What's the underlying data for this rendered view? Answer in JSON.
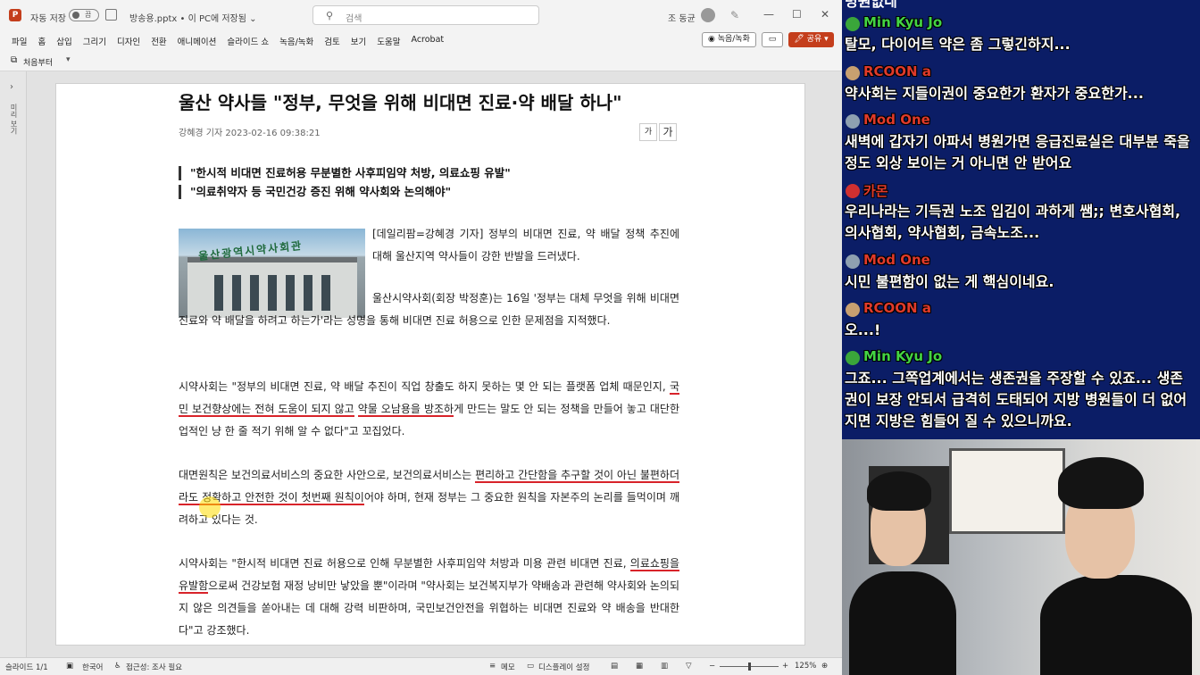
{
  "titlebar": {
    "app_icon": "P",
    "autosave_label": "자동 저장",
    "autosave_state": "끔",
    "filename": "방송용.pptx • 이 PC에 저장됨 ⌄",
    "search_placeholder": "검색",
    "user_name": "조 동균",
    "icons": [
      "powerpoint-icon",
      "save-icon",
      "search-icon",
      "user-avatar-icon",
      "pen-icon",
      "minimize-icon",
      "maximize-icon",
      "close-icon"
    ]
  },
  "menu": {
    "tabs": [
      "파일",
      "홈",
      "삽입",
      "그리기",
      "디자인",
      "전환",
      "애니메이션",
      "슬라이드 쇼",
      "녹음/녹화",
      "검토",
      "보기",
      "도움말",
      "Acrobat"
    ],
    "record_button": "◉ 녹음/녹화",
    "comment_button": "▭",
    "share_button": "🖊 공유 ▾"
  },
  "qat": {
    "from_start": "처음부터",
    "more": "▾"
  },
  "leftstrip": {
    "label": "미리 보기"
  },
  "article": {
    "headline": "울산 약사들 \"정부, 무엇을 위해 비대면 진료·약 배달 하나\"",
    "byline": "강혜경 기자  2023-02-16 09:38:21",
    "font_small": "가",
    "font_large": "가",
    "summary": [
      "\"한시적 비대면 진료허용 무분별한 사후피임약 처방, 의료쇼핑 유발\"",
      "\"의료취약자 등 국민건강 증진 위해 약사회와 논의해야\""
    ],
    "photo_sign": "울산광역시약사회관",
    "p1": "[데일리팜=강혜경 기자] 정부의 비대면 진료, 약 배달 정책 추진에 대해 울산지역 약사들이 강한 반발을 드러냈다.",
    "p2": "울산시약사회(회장 박정훈)는 16일 '정부는 대체 무엇을 위해 비대면 진료와 약 배달을 하려고 하는가'라는 성명을 통해 비대면 진료 허용으로 인한 문제점을 지적했다.",
    "p3": {
      "a": "시약사회는 \"정부의 비대면 진료, 약 배달 추진이 직업 창출도 하지 못하는 몇 안 되는 플랫폼 업체 때문인지, ",
      "u1": "국민 보건향상에는 전혀 도움이 되지 않고",
      "b": " ",
      "u2": "약물 오남용을 방조하",
      "c": "게 만드는 말도 안 되는 정책을 만들어 놓고 대단한 업적인 냥 한 줄 적기 위해 알 수 없다\"고 꼬집었다."
    },
    "p4": {
      "a": "대면원칙은 보건의료서비스의 중요한 사안으로, 보건의료서비스는 ",
      "u1": "편리하고 간단함을 추구할 것이 아닌 불편하더라도 정확하고 안전한 것이 첫번째 원칙이",
      "b": "어야 하며, 현재 정부는 그 중요한 원칙을 자본주의 논리를 들먹이며 깨려하고 있다는 것."
    },
    "p5": {
      "a": "시약사회는 \"한시적 비대면 진료 허용으로 인해 무분별한 사후피임약 처방과 미용 관련 비대면 진료, ",
      "u1": "의료쇼핑을 유발함",
      "b": "으로써 건강보험 재정 낭비만 낳았을 뿐\"이라며 \"약사회는 보건복지부가 약배송과 관련해 약사회와 논의되지 않은 의견들을 쏟아내는 데 대해 강력 비판하며, 국민보건안전을 위협하는 비대면 진료와 약 배송을 반대한다\"고 강조했다."
    }
  },
  "status": {
    "slide": "슬라이드 1/1",
    "lang": "한국어",
    "accessibility": "접근성: 조사 필요",
    "notes": "메모",
    "display": "디스플레이 설정",
    "zoom": "125%",
    "zoom_minus": "−",
    "zoom_plus": "+"
  },
  "chat": {
    "topline": "병원없네",
    "messages": [
      {
        "name": "Min Kyu Jo",
        "name_color": "#43d443",
        "avatar": "#3aa63a",
        "text": "탈모, 다이어트 약은 좀 그렇긴하지..."
      },
      {
        "name": "RCOON a",
        "name_color": "#e03a2a",
        "avatar": "#c8a070",
        "text": "약사회는 지들이권이 중요한가 환자가 중요한가..."
      },
      {
        "name": "Mod One",
        "name_color": "#e03a2a",
        "avatar": "#8ea0b0",
        "text": "새벽에 갑자기 아파서 병원가면 응급진료실은 대부분 죽을 정도 외상 보이는 거 아니면 안 받어요"
      },
      {
        "name": "카몬",
        "name_color": "#e03a2a",
        "avatar": "#d03030",
        "text": "우리나라는 기득권 노조 입김이 과하게 쌤;; 변호사협회, 의사협회, 약사협회, 금속노조..."
      },
      {
        "name": "Mod One",
        "name_color": "#e03a2a",
        "avatar": "#8ea0b0",
        "text": "시민 불편함이 없는 게 핵심이네요."
      },
      {
        "name": "RCOON a",
        "name_color": "#e03a2a",
        "avatar": "#c8a070",
        "text": "오...!"
      },
      {
        "name": "Min Kyu Jo",
        "name_color": "#43d443",
        "avatar": "#3aa63a",
        "text": "그죠... 그쪽업계에서는 생존권을 주장할 수 있죠... 생존권이 보장 안되서 급격히 도태되어 지방 병원들이 더 없어지면 지방은 힘들어 질 수 있으니까요."
      }
    ]
  }
}
